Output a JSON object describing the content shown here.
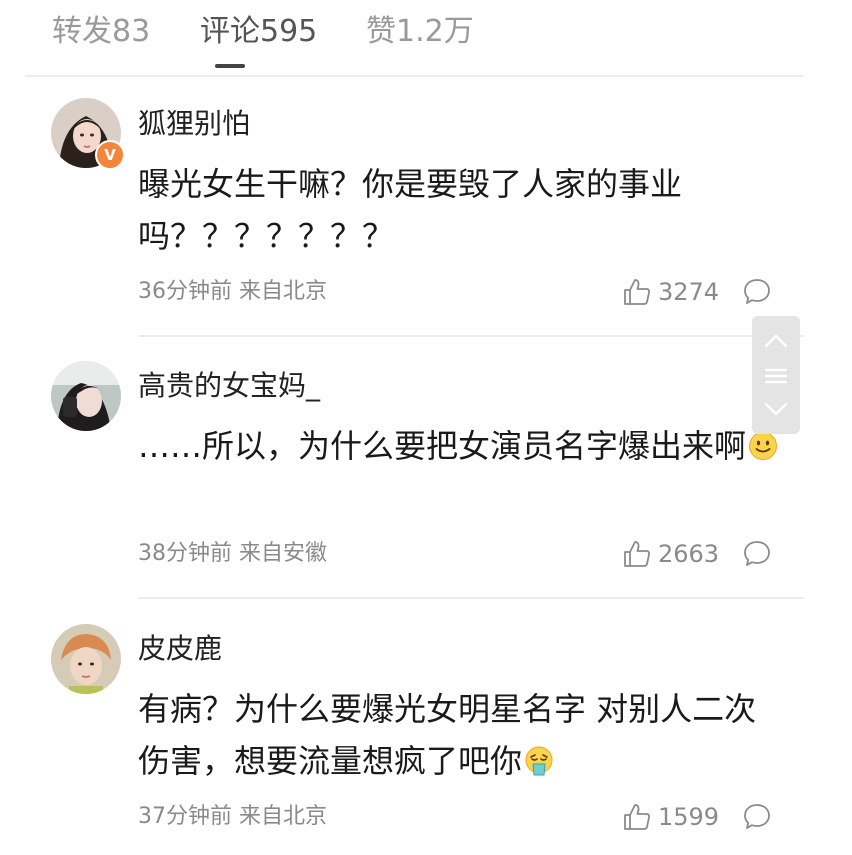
{
  "tabs": [
    {
      "label": "转发83"
    },
    {
      "label": "评论595"
    },
    {
      "label": "赞1.2万"
    }
  ],
  "comments": [
    {
      "username": "狐狸别怕",
      "verified_badge": "V",
      "content": "曝光女生干嘛？你是要毁了人家的事业吗？？？？？？？",
      "time_location": "36分钟前 来自北京",
      "likes": "3274"
    },
    {
      "username": "高贵的女宝妈_",
      "content": "……所以，为什么要把女演员名字爆出来啊",
      "emoji": "smile-emoji",
      "time_location": "38分钟前 来自安徽",
      "likes": "2663"
    },
    {
      "username": "皮皮鹿",
      "content": "有病？为什么要爆光女明星名字 对别人二次伤害，想要流量想疯了吧你",
      "emoji": "vomit-emoji",
      "time_location": "37分钟前 来自北京",
      "likes": "1599"
    }
  ],
  "colors": {
    "badge": "#f3863a",
    "meta": "#8a8a8a",
    "active_tab": "#555555",
    "inactive_tab": "#9a9a9a"
  }
}
